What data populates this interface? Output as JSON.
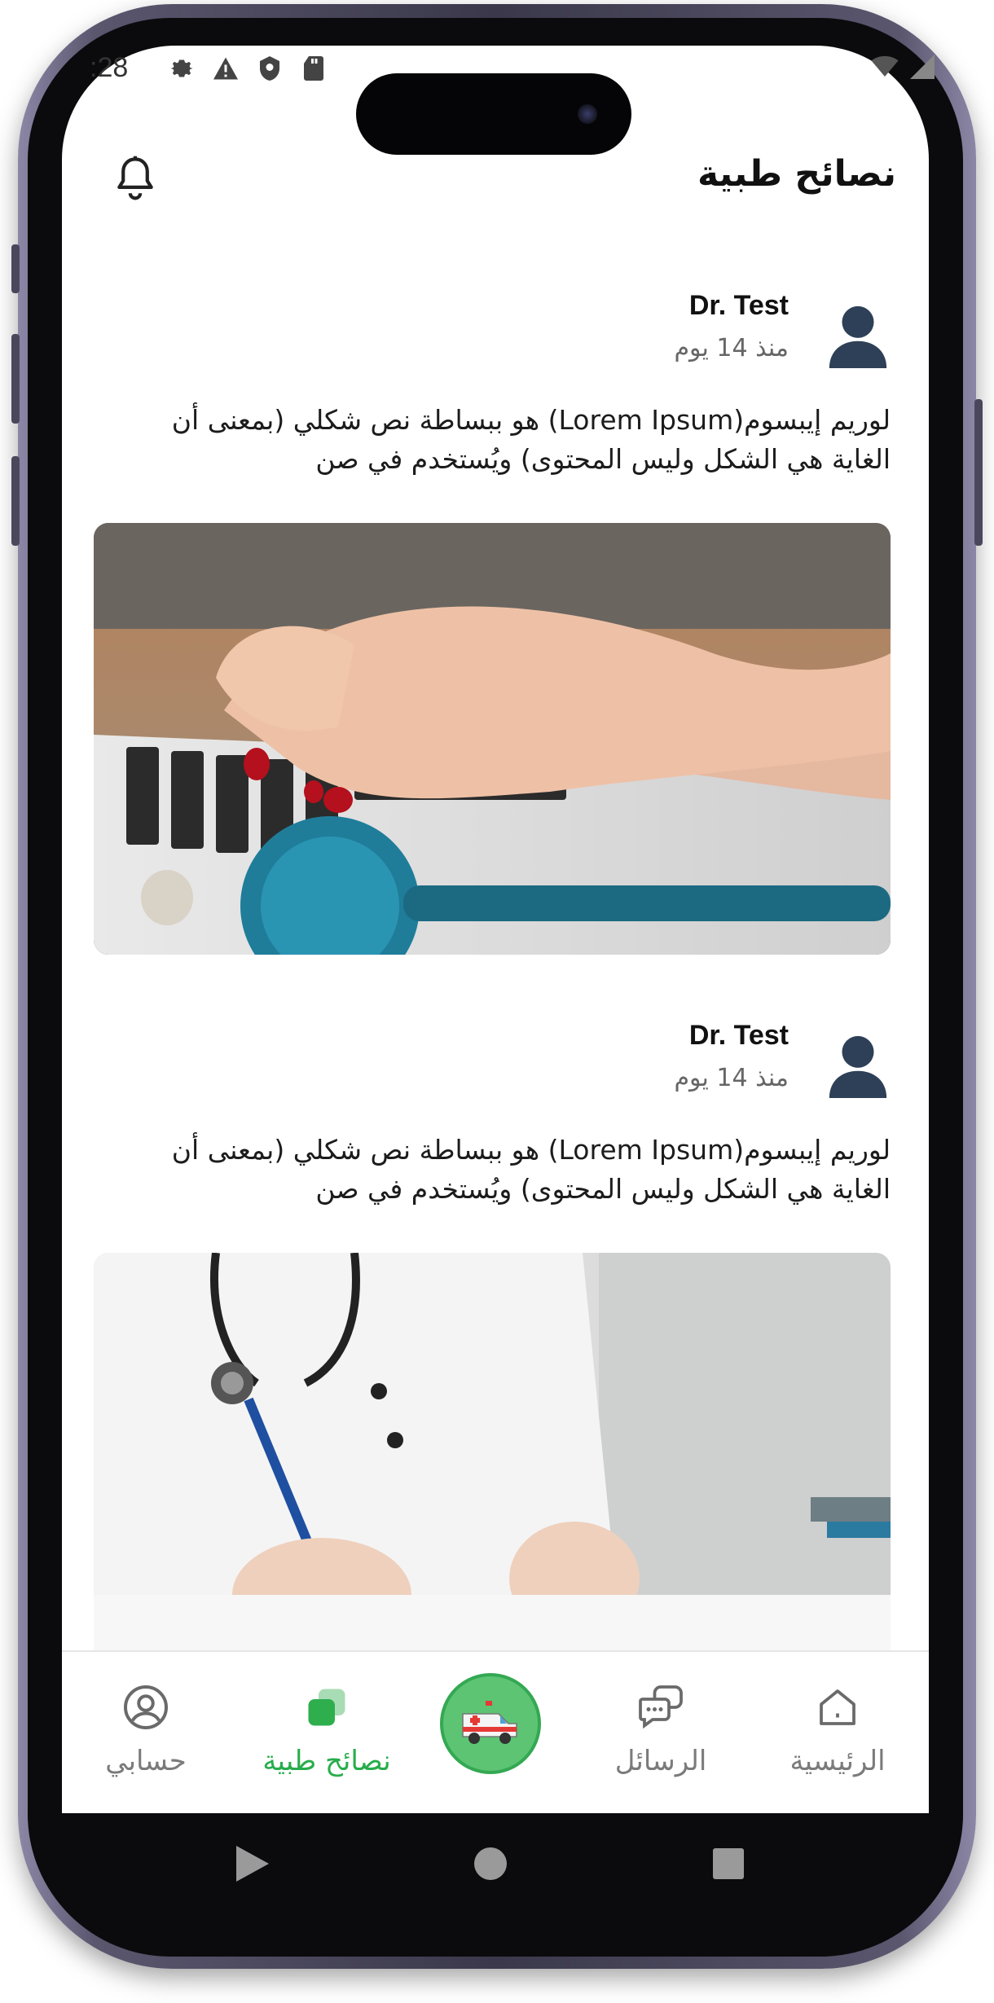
{
  "status_bar": {
    "time": ":28"
  },
  "header": {
    "title": "نصائح طبية"
  },
  "posts": [
    {
      "author": "Dr. Test",
      "time_ago": "منذ 14 يوم",
      "text_line1": "لوريم إيبسوم(Lorem Ipsum) هو ببساطة نص شكلي (بمعنى أن",
      "text_line2": "الغاية هي الشكل وليس المحتوى) ويُستخدم في صن"
    },
    {
      "author": "Dr. Test",
      "time_ago": "منذ 14 يوم",
      "text_line1": "لوريم إيبسوم(Lorem Ipsum) هو ببساطة نص شكلي (بمعنى أن",
      "text_line2": "الغاية هي الشكل وليس المحتوى) ويُستخدم في صن"
    }
  ],
  "tabs": [
    {
      "label": "حسابي"
    },
    {
      "label": "نصائح طبية"
    },
    {
      "label": "الرسائل"
    },
    {
      "label": "الرئيسية"
    }
  ],
  "colors": {
    "accent": "#27ad4b",
    "avatar": "#2e4057"
  }
}
